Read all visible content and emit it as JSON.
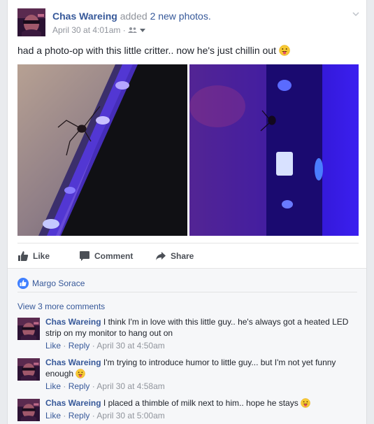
{
  "post": {
    "author": "Chas Wareing",
    "action_text": "added",
    "photo_count_text": "2 new photos.",
    "timestamp": "April 30 at 4:01am",
    "separator": "·",
    "text": "had a photo-op with this little critter.. now he's just chillin out",
    "icons": {
      "audience": "friends-icon",
      "audience_caret": "caret-down-icon",
      "options": "chevron-down-icon",
      "emoji": "tongue-out-emoji"
    }
  },
  "actions": {
    "like": "Like",
    "comment": "Comment",
    "share": "Share"
  },
  "likes": {
    "names": "Margo Sorace"
  },
  "comments_section": {
    "view_more": "View 3 more comments",
    "comments": [
      {
        "author": "Chas Wareing",
        "text": "I think I'm in love with this little guy.. he's always got a heated LED strip on my monitor to hang out on",
        "like": "Like",
        "reply": "Reply",
        "time": "April 30 at 4:50am"
      },
      {
        "author": "Chas Wareing",
        "text": "I'm trying to introduce humor to little guy... but I'm not yet funny enough",
        "like": "Like",
        "reply": "Reply",
        "time": "April 30 at 4:58am"
      },
      {
        "author": "Chas Wareing",
        "text": "I placed a thimble of milk next to him.. hope he stays",
        "like": "Like",
        "reply": "Reply",
        "time": "April 30 at 5:00am"
      }
    ]
  },
  "colors": {
    "link": "#365899",
    "muted": "#90949c",
    "like_badge": "#4080ff"
  }
}
